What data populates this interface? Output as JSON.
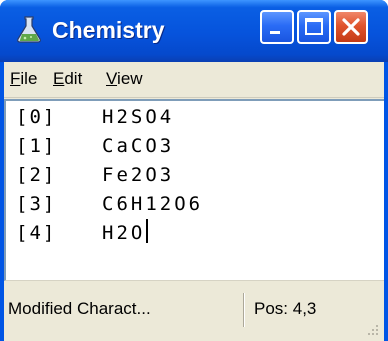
{
  "window": {
    "title": "Chemistry"
  },
  "menu": {
    "items": [
      "File",
      "Edit",
      "View"
    ]
  },
  "editor": {
    "lines": [
      {
        "index": "[0]",
        "value": "H2SO4"
      },
      {
        "index": "[1]",
        "value": "CaCO3"
      },
      {
        "index": "[2]",
        "value": "Fe2O3"
      },
      {
        "index": "[3]",
        "value": "C6H12O6"
      },
      {
        "index": "[4]",
        "value": "H2O"
      }
    ]
  },
  "status": {
    "message": "Modified Charact...",
    "position": "Pos: 4,3"
  },
  "colors": {
    "titlebar": "#0653dc",
    "close_button": "#e0542d",
    "face": "#ece9d8"
  }
}
